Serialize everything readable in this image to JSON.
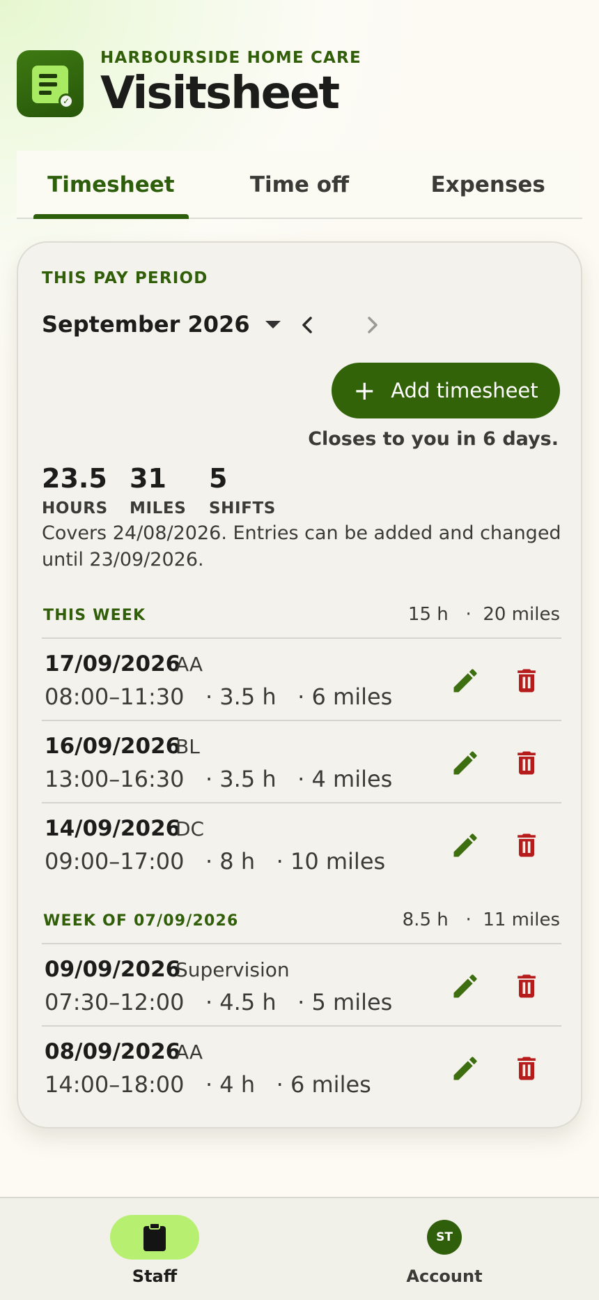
{
  "header": {
    "org": "HARBOURSIDE HOME CARE",
    "title": "Visitsheet",
    "icon": "app-doc-check-icon"
  },
  "tabs": [
    {
      "label": "Timesheet",
      "active": true
    },
    {
      "label": "Time off",
      "active": false
    },
    {
      "label": "Expenses",
      "active": false
    }
  ],
  "period": {
    "label": "THIS PAY PERIOD",
    "month": "September 2026",
    "add_button": "Add timesheet",
    "closes": "Closes to you in 6 days.",
    "stats": [
      {
        "value": "23.5",
        "label": "HOURS"
      },
      {
        "value": "31",
        "label": "MILES"
      },
      {
        "value": "5",
        "label": "SHIFTS"
      }
    ],
    "covers": "Covers 24/08/2026. Entries can be added and changed until 23/09/2026."
  },
  "weeks": [
    {
      "label": "THIS WEEK",
      "summary": "15 h   ·  20 miles",
      "entries": [
        {
          "date": "17/09/2026",
          "client": "AA",
          "detail": "08:00–11:30   · 3.5 h   · 6 miles"
        },
        {
          "date": "16/09/2026",
          "client": "BL",
          "detail": "13:00–16:30   · 3.5 h   · 4 miles"
        },
        {
          "date": "14/09/2026",
          "client": "DC",
          "detail": "09:00–17:00   · 8 h   · 10 miles"
        }
      ]
    },
    {
      "label": "WEEK OF 07/09/2026",
      "summary": "8.5 h   ·  11 miles",
      "entries": [
        {
          "date": "09/09/2026",
          "client": "Supervision",
          "detail": "07:30–12:00   · 4.5 h   · 5 miles"
        },
        {
          "date": "08/09/2026",
          "client": "AA",
          "detail": "14:00–18:00   · 4 h   · 6 miles"
        }
      ]
    }
  ],
  "bottom_nav": [
    {
      "label": "Staff",
      "icon": "clipboard-icon",
      "active": true
    },
    {
      "label": "Account",
      "avatar": "ST",
      "active": false
    }
  ],
  "colors": {
    "accent": "#336309",
    "accent_light": "#b7ef70",
    "danger": "#b71c1c",
    "edit": "#3d6e10"
  }
}
